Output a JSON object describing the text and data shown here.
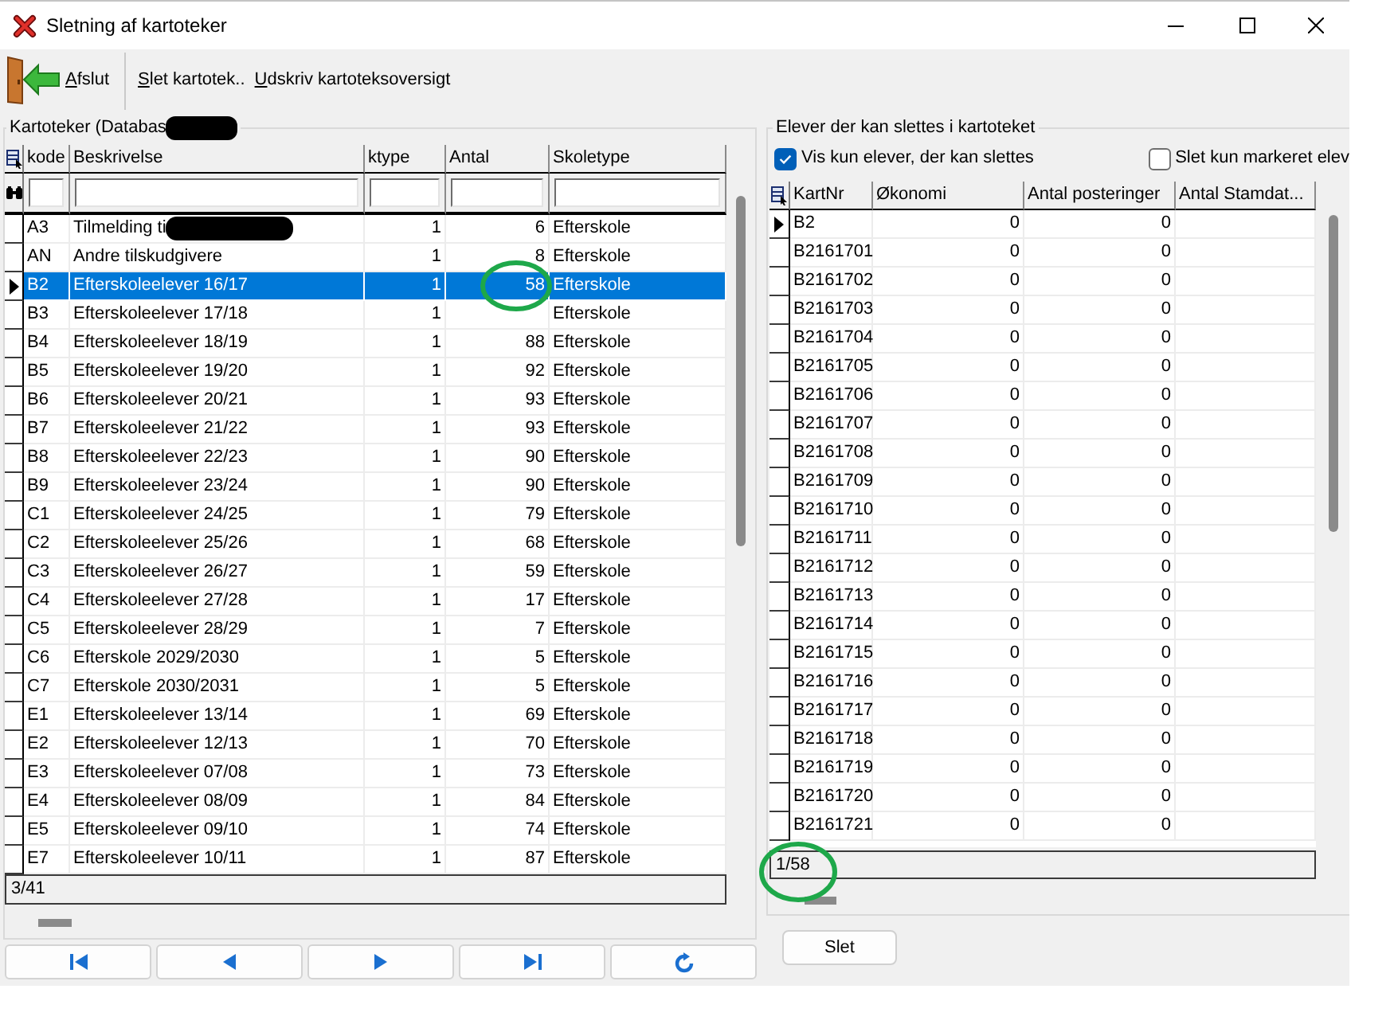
{
  "window": {
    "title": "Sletning af kartoteker"
  },
  "toolbar": {
    "items": [
      {
        "kind": "exit",
        "label": "Afslut"
      },
      {
        "kind": "separator"
      },
      {
        "kind": "text",
        "label": "Slet kartotek.."
      },
      {
        "kind": "text",
        "label": "Udskriv kartoteksoversigt"
      }
    ]
  },
  "left_group": {
    "label": "Kartoteker (Databas",
    "redacted": true
  },
  "left_table": {
    "columns": [
      "kode",
      "Beskrivelse",
      "ktype",
      "Antal",
      "Skoletype"
    ],
    "rows": [
      {
        "cells": [
          "A3",
          "Tilmelding ti",
          "1",
          "6",
          "Efterskole"
        ],
        "selected": false,
        "redacted": true
      },
      {
        "cells": [
          "AN",
          "Andre tilskudgivere",
          "1",
          "8",
          "Efterskole"
        ],
        "selected": false,
        "redacted": false
      },
      {
        "cells": [
          "B2",
          "Efterskoleelever 16/17",
          "1",
          "58",
          "Efterskole"
        ],
        "selected": true,
        "redacted": false
      },
      {
        "cells": [
          "B3",
          "Efterskoleelever 17/18",
          "1",
          null,
          "Efterskole"
        ],
        "selected": false,
        "redacted": false
      },
      {
        "cells": [
          "B4",
          "Efterskoleelever 18/19",
          "1",
          "88",
          "Efterskole"
        ],
        "selected": false,
        "redacted": false
      },
      {
        "cells": [
          "B5",
          "Efterskoleelever 19/20",
          "1",
          "92",
          "Efterskole"
        ],
        "selected": false,
        "redacted": false
      },
      {
        "cells": [
          "B6",
          "Efterskoleelever 20/21",
          "1",
          "93",
          "Efterskole"
        ],
        "selected": false,
        "redacted": false
      },
      {
        "cells": [
          "B7",
          "Efterskoleelever 21/22",
          "1",
          "93",
          "Efterskole"
        ],
        "selected": false,
        "redacted": false
      },
      {
        "cells": [
          "B8",
          "Efterskoleelever 22/23",
          "1",
          "90",
          "Efterskole"
        ],
        "selected": false,
        "redacted": false
      },
      {
        "cells": [
          "B9",
          "Efterskoleelever 23/24",
          "1",
          "90",
          "Efterskole"
        ],
        "selected": false,
        "redacted": false
      },
      {
        "cells": [
          "C1",
          "Efterskoleelever 24/25",
          "1",
          "79",
          "Efterskole"
        ],
        "selected": false,
        "redacted": false
      },
      {
        "cells": [
          "C2",
          "Efterskoleelever 25/26",
          "1",
          "68",
          "Efterskole"
        ],
        "selected": false,
        "redacted": false
      },
      {
        "cells": [
          "C3",
          "Efterskoleelever 26/27",
          "1",
          "59",
          "Efterskole"
        ],
        "selected": false,
        "redacted": false
      },
      {
        "cells": [
          "C4",
          "Efterskoleelever 27/28",
          "1",
          "17",
          "Efterskole"
        ],
        "selected": false,
        "redacted": false
      },
      {
        "cells": [
          "C5",
          "Efterskoleelever 28/29",
          "1",
          "7",
          "Efterskole"
        ],
        "selected": false,
        "redacted": false
      },
      {
        "cells": [
          "C6",
          "Efterskole 2029/2030",
          "1",
          "5",
          "Efterskole"
        ],
        "selected": false,
        "redacted": false
      },
      {
        "cells": [
          "C7",
          "Efterskole 2030/2031",
          "1",
          "5",
          "Efterskole"
        ],
        "selected": false,
        "redacted": false
      },
      {
        "cells": [
          "E1",
          "Efterskoleelever 13/14",
          "1",
          "69",
          "Efterskole"
        ],
        "selected": false,
        "redacted": false
      },
      {
        "cells": [
          "E2",
          "Efterskoleelever 12/13",
          "1",
          "70",
          "Efterskole"
        ],
        "selected": false,
        "redacted": false
      },
      {
        "cells": [
          "E3",
          "Efterskoleelever 07/08",
          "1",
          "73",
          "Efterskole"
        ],
        "selected": false,
        "redacted": false
      },
      {
        "cells": [
          "E4",
          "Efterskoleelever 08/09",
          "1",
          "84",
          "Efterskole"
        ],
        "selected": false,
        "redacted": false
      },
      {
        "cells": [
          "E5",
          "Efterskoleelever 09/10",
          "1",
          "74",
          "Efterskole"
        ],
        "selected": false,
        "redacted": false
      },
      {
        "cells": [
          "E7",
          "Efterskoleelever 10/11",
          "1",
          "87",
          "Efterskole"
        ],
        "selected": false,
        "redacted": false
      }
    ],
    "status": "3/41"
  },
  "navigator": [
    {
      "kind": "first"
    },
    {
      "kind": "previous"
    },
    {
      "kind": "next"
    },
    {
      "kind": "last"
    },
    {
      "kind": "refresh"
    }
  ],
  "right_group": {
    "label": "Elever der kan slettes i kartoteket",
    "checkboxes": [
      {
        "label": "Vis kun elever, der kan slettes",
        "checked": true
      },
      {
        "label": "Slet kun markeret elev",
        "checked": false
      }
    ]
  },
  "right_table": {
    "columns": [
      "KartNr",
      "Økonomi",
      "Antal posteringer",
      "Antal Stamdat..."
    ],
    "rows": [
      {
        "cells": [
          "B2",
          "0",
          "0"
        ],
        "selected": true
      },
      {
        "cells": [
          "B2161701",
          "0",
          "0"
        ],
        "selected": false
      },
      {
        "cells": [
          "B2161702",
          "0",
          "0"
        ],
        "selected": false
      },
      {
        "cells": [
          "B2161703",
          "0",
          "0"
        ],
        "selected": false
      },
      {
        "cells": [
          "B2161704",
          "0",
          "0"
        ],
        "selected": false
      },
      {
        "cells": [
          "B2161705",
          "0",
          "0"
        ],
        "selected": false
      },
      {
        "cells": [
          "B2161706",
          "0",
          "0"
        ],
        "selected": false
      },
      {
        "cells": [
          "B2161707",
          "0",
          "0"
        ],
        "selected": false
      },
      {
        "cells": [
          "B2161708",
          "0",
          "0"
        ],
        "selected": false
      },
      {
        "cells": [
          "B2161709",
          "0",
          "0"
        ],
        "selected": false
      },
      {
        "cells": [
          "B2161710",
          "0",
          "0"
        ],
        "selected": false
      },
      {
        "cells": [
          "B2161711",
          "0",
          "0"
        ],
        "selected": false
      },
      {
        "cells": [
          "B2161712",
          "0",
          "0"
        ],
        "selected": false
      },
      {
        "cells": [
          "B2161713",
          "0",
          "0"
        ],
        "selected": false
      },
      {
        "cells": [
          "B2161714",
          "0",
          "0"
        ],
        "selected": false
      },
      {
        "cells": [
          "B2161715",
          "0",
          "0"
        ],
        "selected": false
      },
      {
        "cells": [
          "B2161716",
          "0",
          "0"
        ],
        "selected": false
      },
      {
        "cells": [
          "B2161717",
          "0",
          "0"
        ],
        "selected": false
      },
      {
        "cells": [
          "B2161718",
          "0",
          "0"
        ],
        "selected": false
      },
      {
        "cells": [
          "B2161719",
          "0",
          "0"
        ],
        "selected": false
      },
      {
        "cells": [
          "B2161720",
          "0",
          "0"
        ],
        "selected": false
      },
      {
        "cells": [
          "B2161721",
          "0",
          "0"
        ],
        "selected": false
      }
    ],
    "status": "1/58"
  },
  "delete_button": {
    "label": "Slet"
  }
}
